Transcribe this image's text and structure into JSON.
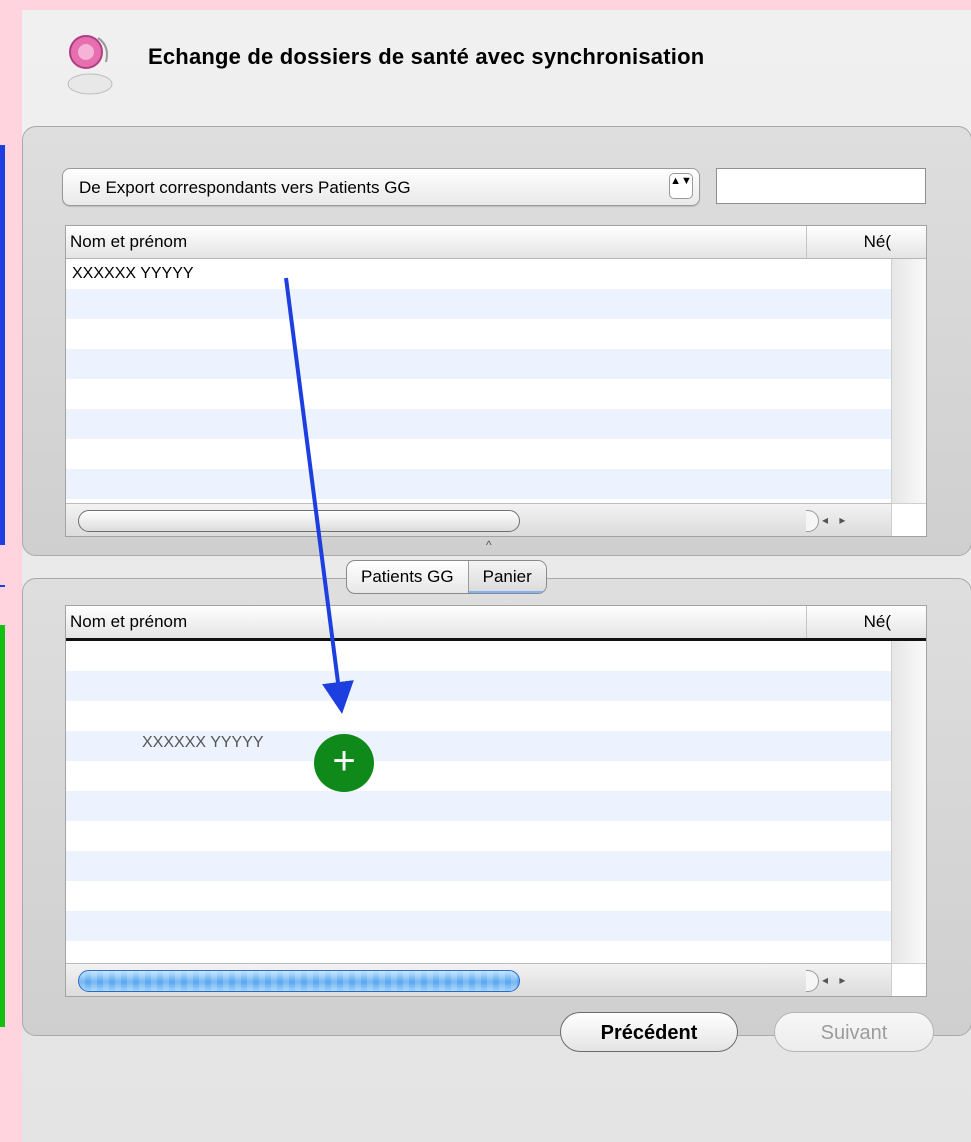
{
  "window": {
    "title": "Echange de dossiers de santé avec synchronisation"
  },
  "source": {
    "popup_value": "De Export correspondants vers Patients GG",
    "popup_arrows": "▲▼",
    "search_value": "",
    "columns": {
      "name": "Nom et prénom",
      "born": "Né("
    },
    "rows": [
      "XXXXXX YYYYY",
      "",
      "",
      "",
      "",
      "",
      "",
      "",
      ""
    ]
  },
  "segmented": {
    "tabs": [
      "Patients GG",
      "Panier"
    ],
    "selected": "Panier"
  },
  "destination": {
    "columns": {
      "name": "Nom et prénom",
      "born": "Né("
    },
    "rows": [
      "",
      "",
      "",
      "",
      "",
      "",
      "",
      "",
      "",
      "",
      "",
      ""
    ],
    "dragging_item": "XXXXXX YYYYY",
    "add_badge": "+"
  },
  "scroll": {
    "arrows": "◂ ▸"
  },
  "splitter": {
    "caret": "^"
  },
  "buttons": {
    "previous": "Précédent",
    "next": "Suivant"
  },
  "colors": {
    "background": "#ffd4de",
    "annotation_blue": "#1e3fe0",
    "annotation_green": "#11c011",
    "add_badge": "#0f8a1a"
  }
}
